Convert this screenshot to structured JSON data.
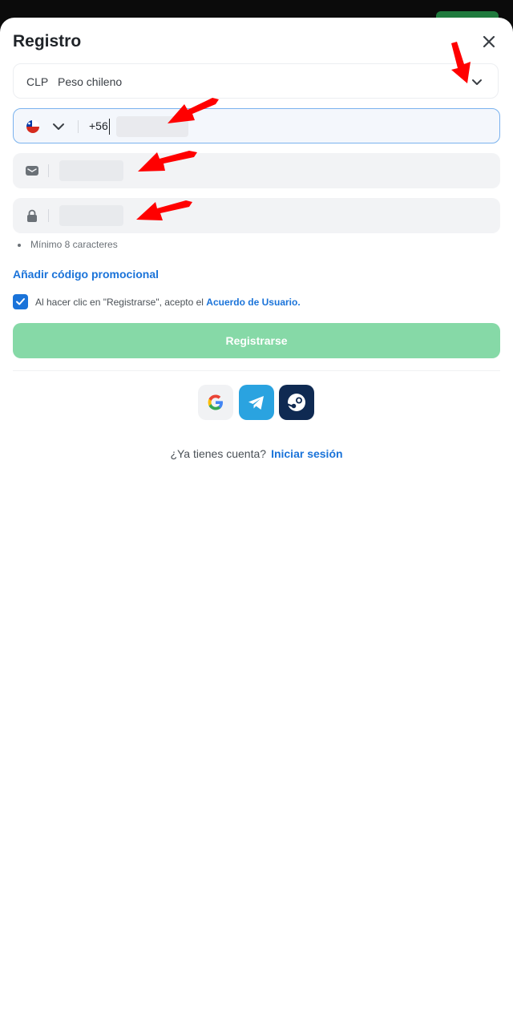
{
  "sheet": {
    "title": "Registro"
  },
  "currency": {
    "code": "CLP",
    "name": "Peso chileno"
  },
  "phone": {
    "prefix": "+56"
  },
  "password": {
    "hint": "Mínimo 8 caracteres"
  },
  "promo": {
    "label": "Añadir código promocional"
  },
  "agreement": {
    "text": "Al hacer clic en \"Registrarse\", acepto el",
    "link": "Acuerdo de Usuario.",
    "checked": true
  },
  "submit": {
    "label": "Registrarse"
  },
  "social": [
    "google-icon",
    "telegram-icon",
    "steam-icon"
  ],
  "login": {
    "question": "¿Ya tienes cuenta?",
    "link": "Iniciar sesión"
  },
  "colors": {
    "accent": "#1a73d9",
    "submit_bg": "#86d9a7",
    "arrow": "#ff0000"
  }
}
